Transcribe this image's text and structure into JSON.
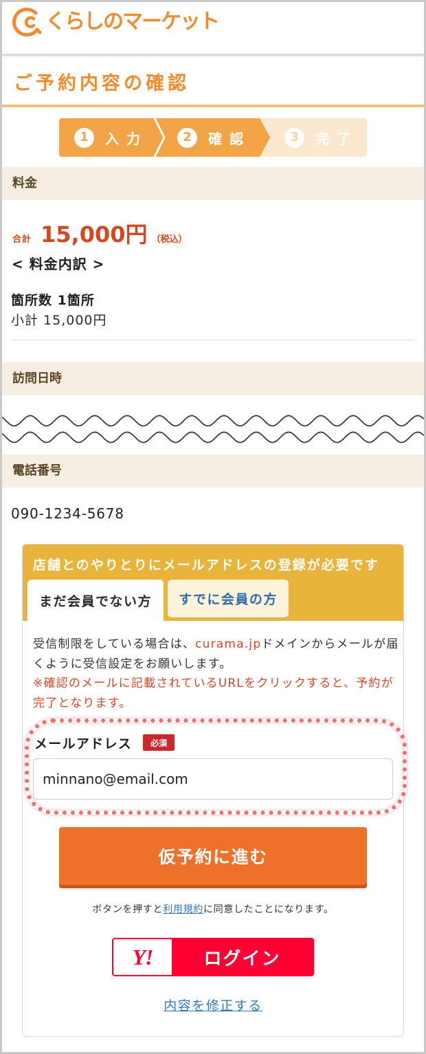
{
  "header": {
    "logo_text": "くらしのマーケット"
  },
  "page_title": "ご予約内容の確認",
  "steps": [
    {
      "number": "1",
      "label": "入力",
      "active": true
    },
    {
      "number": "2",
      "label": "確認",
      "active": true
    },
    {
      "number": "3",
      "label": "完了",
      "active": false
    }
  ],
  "fee": {
    "section_title": "料金",
    "total_label": "合計",
    "total_amount": "15,000円",
    "tax_note": "（税込）",
    "breakdown_title": "< 料金内訳 >",
    "count_line": "箇所数 1箇所",
    "subtotal_line": "小計 15,000円"
  },
  "visit": {
    "section_title": "訪問日時"
  },
  "phone": {
    "section_title": "電話番号",
    "number": "090-1234-5678"
  },
  "email_card": {
    "header_text": "店舗とのやりとりにメールアドレスの登録が必要です",
    "tabs": [
      {
        "label": "まだ会員でない方",
        "selected": true
      },
      {
        "label": "すでに会員の方",
        "selected": false
      }
    ],
    "notice": {
      "before": "受信制限をしている場合は、",
      "domain": "curama.jp",
      "after": "ドメインからメールが届くように受信設定をお願いします。"
    },
    "warning": "※確認のメールに記載されているURLをクリックすると、予約が完了となります。",
    "email_label": "メールアドレス",
    "required_badge": "必須",
    "email_value": "minnano@email.com",
    "submit_label": "仮予約に進む",
    "terms": {
      "before": "ボタンを押すと",
      "link": "利用規約",
      "after": "に同意したことになります。"
    },
    "yahoo_login": {
      "logo_text": "Y!",
      "label": "ログイン"
    },
    "edit_link": "内容を修正する"
  },
  "icons": {
    "logo": "curama-logo-icon",
    "content_break": "wavy-break-icon"
  },
  "colors": {
    "brand-orange": "#f08c2e",
    "title-rule": "#f6c07a",
    "step-active": "#f2a447",
    "step-inactive": "#fce7cf",
    "section-bg": "#f6eee2",
    "section-text": "#5c4526",
    "price-red": "#d5481d",
    "card-header": "#e9b43b",
    "tab-inactive-bg": "#fdf3da",
    "tab-inactive-text": "#2b6cb0",
    "warning-red": "#d9442a",
    "required-badge": "#c8282e",
    "submit-button": "#ef7129",
    "yahoo-red": "#ff0033",
    "link-blue": "#2e78c2"
  }
}
